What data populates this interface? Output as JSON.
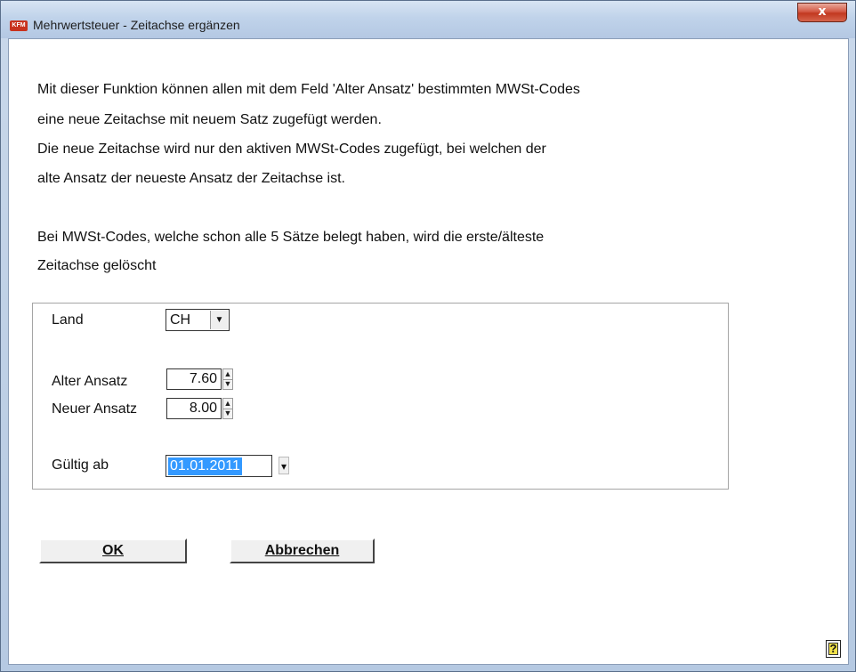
{
  "window": {
    "app_icon": "KFM",
    "title": "Mehrwertsteuer - Zeitachse ergänzen",
    "close_glyph": "x"
  },
  "description": [
    "Mit dieser Funktion können allen mit dem Feld 'Alter Ansatz' bestimmten MWSt-Codes",
    "eine neue Zeitachse mit neuem Satz zugefügt werden.",
    "Die neue Zeitachse wird nur den aktiven MWSt-Codes zugefügt, bei welchen der",
    "alte Ansatz der neueste Ansatz der Zeitachse ist.",
    "Bei MWSt-Codes, welche schon alle 5 Sätze belegt haben, wird die erste/älteste",
    "Zeitachse gelöscht"
  ],
  "form": {
    "land_label": "Land",
    "land_value": "CH",
    "alter_label": "Alter Ansatz",
    "alter_value": "7.60",
    "neuer_label": "Neuer Ansatz",
    "neuer_value": "8.00",
    "gueltig_label": "Gültig ab",
    "gueltig_value": "01.01.2011"
  },
  "buttons": {
    "ok_label": "OK",
    "cancel_label": "Abbrechen",
    "help_glyph": "?"
  },
  "icons": {
    "dropdown": "chevron-down-icon",
    "spin_up": "spin-up-icon",
    "spin_down": "spin-down-icon",
    "date_picker": "calendar-dropdown-icon",
    "help": "help-icon",
    "close": "close-icon"
  },
  "colors": {
    "close_button": "#c2381f",
    "selection": "#3399ff",
    "help_icon": "#f0e04a"
  }
}
